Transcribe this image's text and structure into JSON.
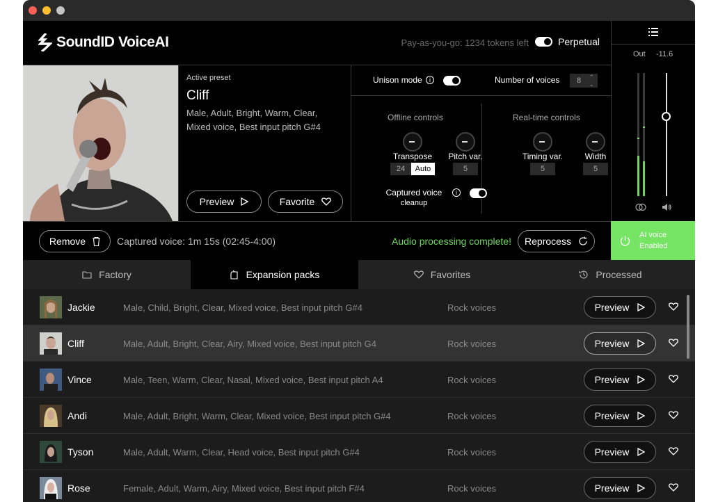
{
  "app": {
    "brand": "SoundID VoiceAI",
    "tokens": "Pay-as-you-go: 1234 tokens left",
    "perpetual_label": "Perpetual"
  },
  "meter": {
    "out_label": "Out",
    "out_value": "-11.6",
    "volume_level": 0.65
  },
  "preset": {
    "label": "Active preset",
    "name": "Cliff",
    "description": "Male, Adult, Bright, Warm, Clear, Mixed voice, Best input pitch  G#4",
    "preview_label": "Preview",
    "favorite_label": "Favorite"
  },
  "controls": {
    "unison_label": "Unison mode",
    "voices_label": "Number of voices",
    "voices_value": "8",
    "offline_title": "Offline controls",
    "realtime_title": "Real-time controls",
    "transpose_label": "Transpose",
    "transpose_value": "24",
    "transpose_mode": "Auto",
    "pitchvar_label": "Pitch var.",
    "pitchvar_value": "5",
    "timingvar_label": "Timing var.",
    "timingvar_value": "5",
    "width_label": "Width",
    "width_value": "5",
    "cleanup_label_1": "Captured voice",
    "cleanup_label_2": "cleanup"
  },
  "status": {
    "remove_label": "Remove",
    "captured": "Captured voice: 1m 15s (02:45-4:00)",
    "complete": "Audio processing complete!",
    "reprocess_label": "Reprocess",
    "ai_line1": "AI voice",
    "ai_line2": "Enabled"
  },
  "tabs": [
    {
      "label": "Factory"
    },
    {
      "label": "Expansion packs"
    },
    {
      "label": "Favorites"
    },
    {
      "label": "Processed"
    }
  ],
  "rows": [
    {
      "name": "Jackie",
      "desc": "Male, Child, Bright, Clear, Mixed voice, Best input pitch G#4",
      "cat": "Rock voices",
      "preview": "Preview"
    },
    {
      "name": "Cliff",
      "desc": "Male, Adult, Bright, Clear, Airy, Mixed voice, Best input pitch  G4",
      "cat": "Rock voices",
      "preview": "Preview"
    },
    {
      "name": "Vince",
      "desc": "Male, Teen, Warm, Clear, Nasal, Mixed voice, Best input pitch  A4",
      "cat": "Rock voices",
      "preview": "Preview"
    },
    {
      "name": "Andi",
      "desc": "Male, Adult, Bright, Warm, Clear, Mixed voice, Best input pitch  G#4",
      "cat": "Rock voices",
      "preview": "Preview"
    },
    {
      "name": "Tyson",
      "desc": "Male, Adult, Warm, Clear, Head voice, Best input pitch  G#4",
      "cat": "Rock voices",
      "preview": "Preview"
    },
    {
      "name": "Rose",
      "desc": "Female, Adult, Warm, Airy, Mixed voice, Best input pitch  F#4",
      "cat": "Rock voices",
      "preview": "Preview"
    }
  ]
}
